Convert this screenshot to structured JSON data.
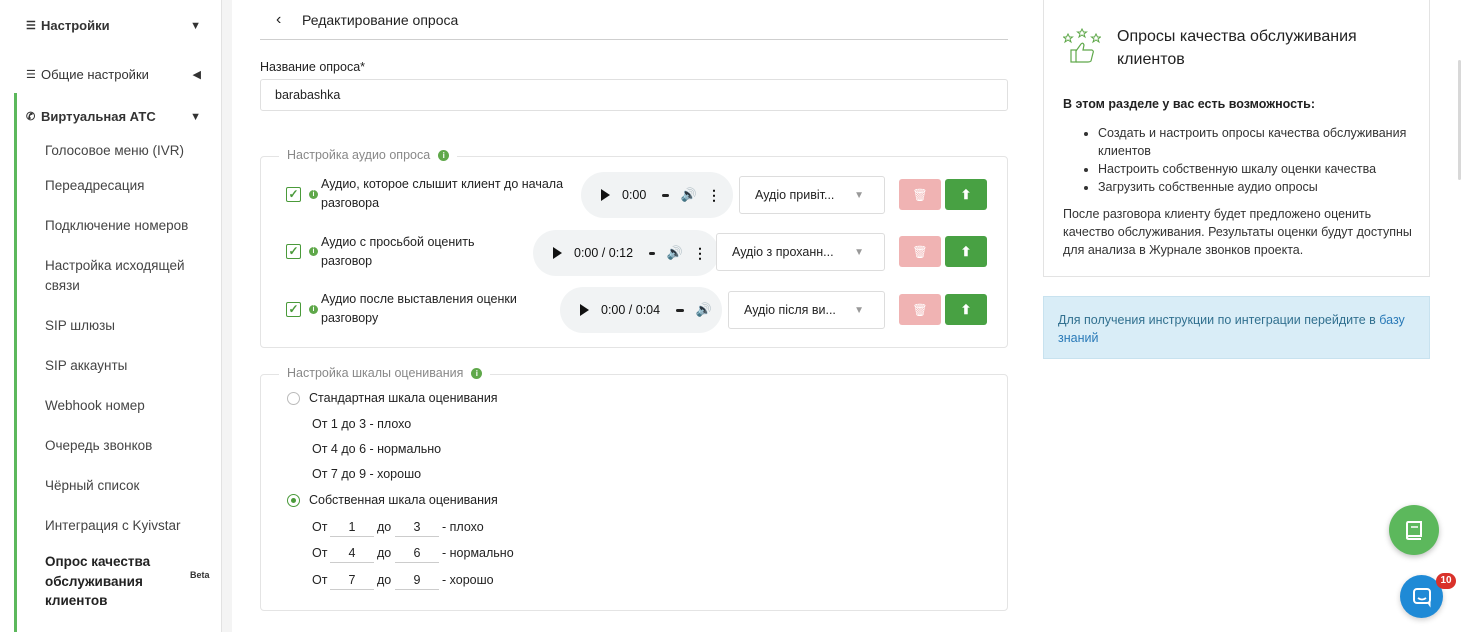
{
  "sidebar": {
    "settings_label": "Настройки",
    "general_label": "Общие настройки",
    "vats_label": "Виртуальная АТС",
    "items": [
      "Голосовое меню (IVR)",
      "Переадресация",
      "Подключение номеров",
      "Настройка исходящей связи",
      "SIP шлюзы",
      "SIP аккаунты",
      "Webhook номер",
      "Очередь звонков",
      "Чёрный список",
      "Интеграция с Kyivstar"
    ],
    "active_item": "Опрос качества обслуживания клиентов",
    "active_badge": "Beta"
  },
  "header": {
    "title": "Редактирование опроса"
  },
  "form": {
    "name_label": "Название опроса*",
    "name_value": "barabashka",
    "audio_section": {
      "legend": "Настройка аудио опроса",
      "rows": [
        {
          "label": "Аудио, которое слышит клиент до начала разговора",
          "time": "0:00",
          "select": "Аудіо привіт..."
        },
        {
          "label": "Аудио с просьбой оценить разговор",
          "time": "0:00 / 0:12",
          "select": "Аудіо з проханн..."
        },
        {
          "label": "Аудио после выставления оценки разговору",
          "time": "0:00 / 0:04",
          "select": "Аудіо після ви..."
        }
      ]
    },
    "scale_section": {
      "legend": "Настройка шкалы оценивания",
      "standard_label": "Стандартная шкала оценивания",
      "standard_lines": [
        "От 1 до 3 - плохо",
        "От 4 до 6 - нормально",
        "От 7 до 9 - хорошо"
      ],
      "custom_label": "Собственная шкала оценивания",
      "from_word": "От",
      "to_word": "до",
      "custom_rows": [
        {
          "from": "1",
          "to": "3",
          "suffix": "- плохо"
        },
        {
          "from": "4",
          "to": "6",
          "suffix": "- нормально"
        },
        {
          "from": "7",
          "to": "9",
          "suffix": "- хорошо"
        }
      ]
    }
  },
  "help": {
    "title": "Опросы качества обслуживания клиентов",
    "subtitle": "В этом разделе у вас есть возможность:",
    "bullets": [
      "Создать и настроить опросы качества обслуживания клиентов",
      "Настроить собственную шкалу оценки качества",
      "Загрузить собственные аудио опросы"
    ],
    "text": "После разговора клиенту будет предложено оценить качество обслуживания. Результаты оценки будут доступны для анализа в Журнале звонков проекта.",
    "info_text": "Для получения инструкции по интеграции перейдите в",
    "info_link": "базу знаний"
  },
  "chat_badge": "10",
  "colors": {
    "accent": "#5cb85c",
    "upload": "#48a143",
    "delete": "#f0b3b3",
    "info_bg": "#d9edf7",
    "chat": "#1f8ad6"
  }
}
